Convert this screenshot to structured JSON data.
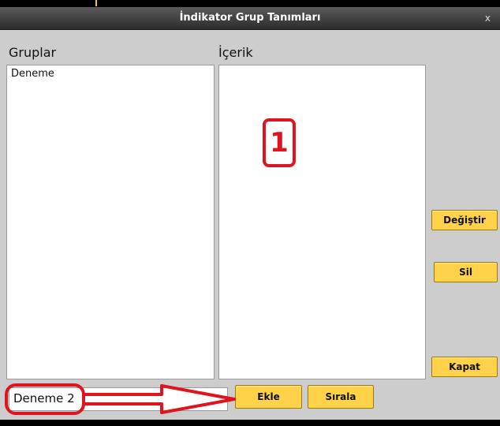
{
  "window": {
    "title": "İndikator Grup Tanımları",
    "close_label": "x"
  },
  "groups_panel": {
    "heading": "Gruplar",
    "items": [
      "Deneme"
    ]
  },
  "content_panel": {
    "heading": "İçerik"
  },
  "buttons": {
    "change": "Değiştir",
    "delete": "Sil",
    "close": "Kapat",
    "add": "Ekle",
    "sort": "Sırala"
  },
  "group_name_input": {
    "value": "Deneme 2"
  },
  "annotations": {
    "step_number": "1",
    "color": "#e0141e"
  },
  "colors": {
    "button_bg": "#ffd24a",
    "dialog_bg": "#cdcdcd",
    "title_bg": "#3a3a3a"
  }
}
